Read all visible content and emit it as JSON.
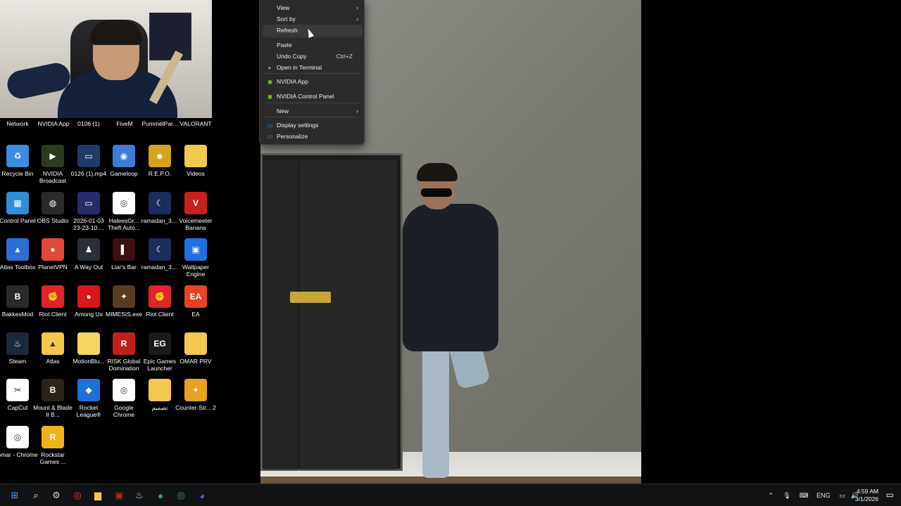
{
  "top_row_labels": [
    "Network",
    "NVIDIA App",
    "0106 (1)",
    "FiveM",
    "PummelPar...",
    "VALORANT"
  ],
  "desktop_icons": [
    {
      "label": "Recycle Bin",
      "icon": "recycle-bin-icon",
      "color": "#3a8de0",
      "glyph": "♻"
    },
    {
      "label": "NVIDIA Broadcast",
      "icon": "nvidia-broadcast-icon",
      "color": "#2e3b1a",
      "glyph": "▶"
    },
    {
      "label": "0126 (1).mp4",
      "icon": "video-file-icon",
      "color": "#1e3a6b",
      "glyph": "▭"
    },
    {
      "label": "Gameloop",
      "icon": "gameloop-icon",
      "color": "#3c7dd8",
      "glyph": "◉"
    },
    {
      "label": "R.E.P.O.",
      "icon": "repo-game-icon",
      "color": "#d6a21e",
      "glyph": "☻"
    },
    {
      "label": "Videos",
      "icon": "folder-icon",
      "color": "#f2c94c",
      "glyph": ""
    },
    {
      "label": "Control Panel",
      "icon": "control-panel-icon",
      "color": "#2f8fd6",
      "glyph": "▦"
    },
    {
      "label": "OBS Studio",
      "icon": "obs-studio-icon",
      "color": "#2b2b2b",
      "glyph": "◍"
    },
    {
      "label": "2026-01-03 23-23-10....",
      "icon": "video-file-icon",
      "color": "#262d6b",
      "glyph": "▭"
    },
    {
      "label": "HaleesGr... Theft Auto...",
      "icon": "chrome-shortcut-icon",
      "color": "#ffffff",
      "glyph": "◎"
    },
    {
      "label": "ramadan_3....",
      "icon": "video-file-icon",
      "color": "#1c2c5c",
      "glyph": "☾"
    },
    {
      "label": "Voicemeeter Banana",
      "icon": "voicemeeter-icon",
      "color": "#c8201e",
      "glyph": "V"
    },
    {
      "label": "Atlas Toolbox",
      "icon": "atlas-toolbox-icon",
      "color": "#2d6fd2",
      "glyph": "▲"
    },
    {
      "label": "PlanetVPN",
      "icon": "planetvpn-icon",
      "color": "#e2473b",
      "glyph": "●"
    },
    {
      "label": "A Way Out",
      "icon": "a-way-out-icon",
      "color": "#2a2f3a",
      "glyph": "♟"
    },
    {
      "label": "Liar's Bar",
      "icon": "liars-bar-icon",
      "color": "#3a1010",
      "glyph": "▌"
    },
    {
      "label": "ramadan_3....",
      "icon": "video-file-icon",
      "color": "#1c2c5c",
      "glyph": "☾"
    },
    {
      "label": "Wallpaper Engine",
      "icon": "wallpaper-engine-icon",
      "color": "#1f6fe0",
      "glyph": "▣"
    },
    {
      "label": "BakkesMod",
      "icon": "bakkesmod-icon",
      "color": "#2a2a2a",
      "glyph": "B"
    },
    {
      "label": "Riot Client",
      "icon": "riot-client-icon",
      "color": "#e0242a",
      "glyph": "✊"
    },
    {
      "label": "Among Us",
      "icon": "among-us-icon",
      "color": "#d8161c",
      "glyph": "●"
    },
    {
      "label": "MIMESIS.exe",
      "icon": "mimesis-icon",
      "color": "#5a3a20",
      "glyph": "✦"
    },
    {
      "label": "Riot Client",
      "icon": "riot-client-icon",
      "color": "#e0242a",
      "glyph": "✊"
    },
    {
      "label": "EA",
      "icon": "ea-icon",
      "color": "#e8421f",
      "glyph": "EA"
    },
    {
      "label": "Steam",
      "icon": "steam-icon",
      "color": "#1b2838",
      "glyph": "♨"
    },
    {
      "label": "Atlas",
      "icon": "folder-icon",
      "color": "#f2c94c",
      "glyph": "▲"
    },
    {
      "label": "MotionBlu...",
      "icon": "folder-icon",
      "color": "#f5d562",
      "glyph": ""
    },
    {
      "label": "RISK Global Domination",
      "icon": "risk-icon",
      "color": "#c0201c",
      "glyph": "R"
    },
    {
      "label": "Epic Games Launcher",
      "icon": "epic-games-icon",
      "color": "#1a1a1a",
      "glyph": "EG"
    },
    {
      "label": "OMAR PRV",
      "icon": "folder-icon",
      "color": "#f2c94c",
      "glyph": ""
    },
    {
      "label": "CapCut",
      "icon": "capcut-icon",
      "color": "#ffffff",
      "glyph": "✂"
    },
    {
      "label": "Mount & Blade II B...",
      "icon": "mount-blade-icon",
      "color": "#2b2418",
      "glyph": "B"
    },
    {
      "label": "Rocket League®",
      "icon": "rocket-league-icon",
      "color": "#1f6fd8",
      "glyph": "◆"
    },
    {
      "label": "Google Chrome",
      "icon": "chrome-icon",
      "color": "#ffffff",
      "glyph": "◎"
    },
    {
      "label": "تصميم",
      "icon": "folder-icon",
      "color": "#f2c94c",
      "glyph": ""
    },
    {
      "label": "Counter-Str... 2",
      "icon": "counter-strike-icon",
      "color": "#e8a21e",
      "glyph": "✦"
    },
    {
      "label": "omar - Chrome",
      "icon": "chrome-profile-icon",
      "color": "#ffffff",
      "glyph": "◎"
    },
    {
      "label": "Rockstar Games ...",
      "icon": "rockstar-icon",
      "color": "#f2b31a",
      "glyph": "R"
    }
  ],
  "context_menu": {
    "items": [
      {
        "label": "View",
        "icon": "",
        "shortcut": "",
        "submenu": true
      },
      {
        "label": "Sort by",
        "icon": "",
        "shortcut": "",
        "submenu": true
      },
      {
        "label": "Refresh",
        "icon": "",
        "shortcut": "",
        "submenu": false
      },
      {
        "label": "Paste",
        "icon": "",
        "shortcut": "",
        "submenu": false
      },
      {
        "label": "Undo Copy",
        "icon": "",
        "shortcut": "Ctrl+Z",
        "submenu": false
      },
      {
        "label": "Open in Terminal",
        "icon": "terminal-icon",
        "shortcut": "",
        "submenu": false
      },
      {
        "label": "NVIDIA App",
        "icon": "nvidia-icon",
        "shortcut": "",
        "submenu": false
      },
      {
        "label": "NVIDIA Control Panel",
        "icon": "nvidia-icon",
        "shortcut": "",
        "submenu": false
      },
      {
        "label": "New",
        "icon": "",
        "shortcut": "",
        "submenu": true
      },
      {
        "label": "Display settings",
        "icon": "display-settings-icon",
        "shortcut": "",
        "submenu": false
      },
      {
        "label": "Personalize",
        "icon": "personalize-icon",
        "shortcut": "",
        "submenu": false
      }
    ],
    "arrow": "›"
  },
  "taskbar": {
    "apps": [
      {
        "name": "start-button",
        "glyph": "⊞",
        "color": "#3aa0ff"
      },
      {
        "name": "search-icon",
        "glyph": "⌕",
        "color": "#ffffff"
      },
      {
        "name": "settings-icon",
        "glyph": "⚙",
        "color": "#d0d0d0"
      },
      {
        "name": "chrome-taskbar-icon",
        "glyph": "◎",
        "color": "#e8453c"
      },
      {
        "name": "file-explorer-icon",
        "glyph": "▆",
        "color": "#f2c94c"
      },
      {
        "name": "recorder-icon",
        "glyph": "▣",
        "color": "#c8201e"
      },
      {
        "name": "steam-taskbar-icon",
        "glyph": "♨",
        "color": "#c7d5e0"
      },
      {
        "name": "spotify-icon",
        "glyph": "●",
        "color": "#1db954"
      },
      {
        "name": "chrome-profile-taskbar-icon",
        "glyph": "◎",
        "color": "#4caf50"
      },
      {
        "name": "discord-icon",
        "glyph": "◕",
        "color": "#5865f2"
      }
    ],
    "tray": {
      "language": "ENG",
      "time": "4:59 AM",
      "date": "3/1/2026"
    }
  }
}
